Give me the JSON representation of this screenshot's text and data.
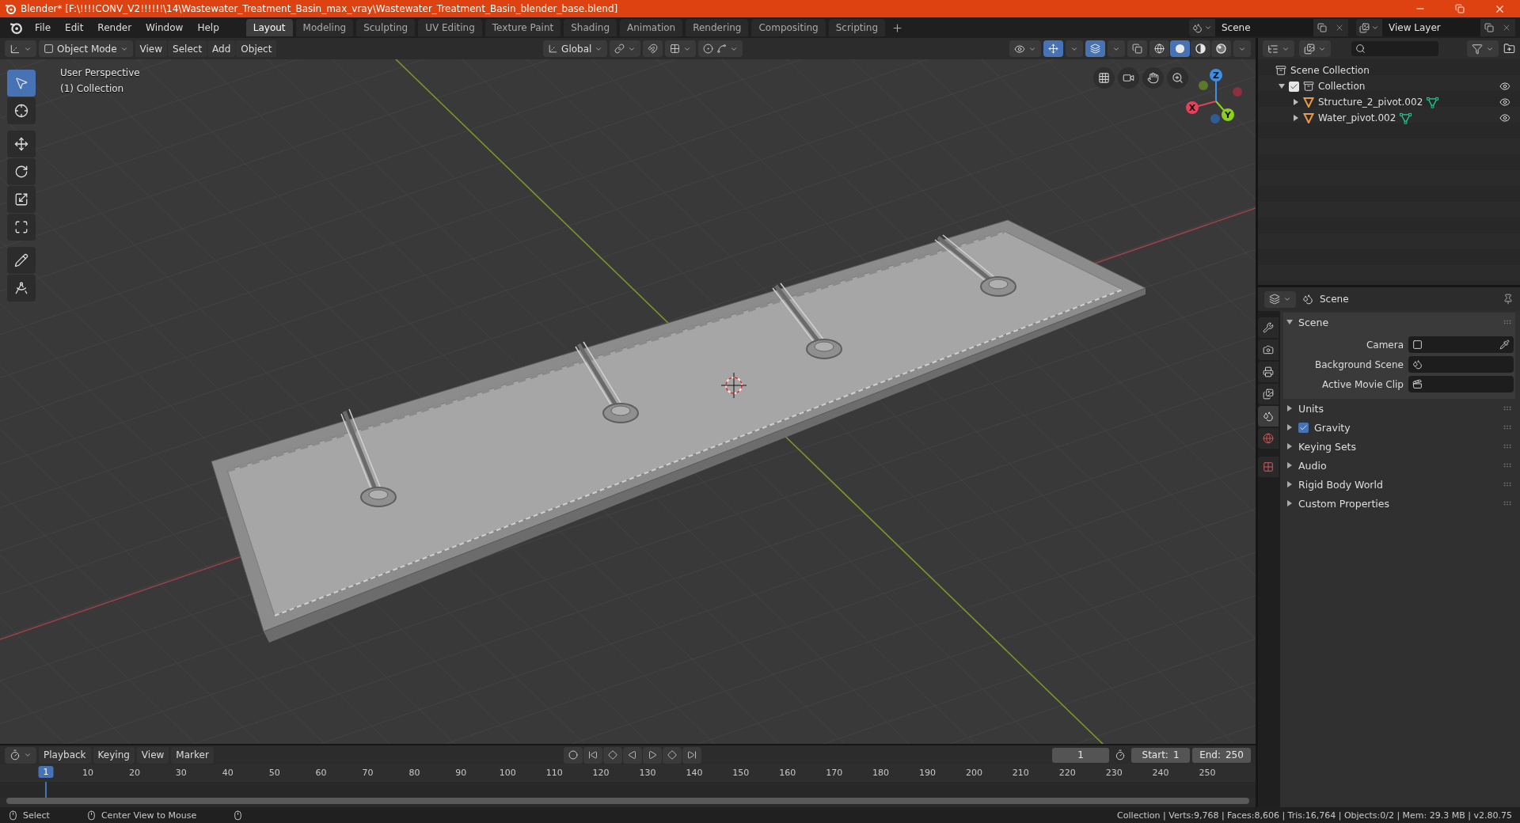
{
  "window": {
    "title": "Blender* [F:\\!!!!CONV_V2!!!!!!\\14\\Wastewater_Treatment_Basin_max_vray\\Wastewater_Treatment_Basin_blender_base.blend]"
  },
  "menu": [
    "File",
    "Edit",
    "Render",
    "Window",
    "Help"
  ],
  "workspace_tabs": [
    {
      "label": "Layout",
      "selected": true
    },
    {
      "label": "Modeling",
      "selected": false
    },
    {
      "label": "Sculpting",
      "selected": false
    },
    {
      "label": "UV Editing",
      "selected": false
    },
    {
      "label": "Texture Paint",
      "selected": false
    },
    {
      "label": "Shading",
      "selected": false
    },
    {
      "label": "Animation",
      "selected": false
    },
    {
      "label": "Rendering",
      "selected": false
    },
    {
      "label": "Compositing",
      "selected": false
    },
    {
      "label": "Scripting",
      "selected": false
    }
  ],
  "scene_selector": {
    "value": "Scene"
  },
  "view_layer_selector": {
    "value": "View Layer"
  },
  "viewport": {
    "mode": "Object Mode",
    "menus": [
      "View",
      "Select",
      "Add",
      "Object"
    ],
    "orientation": "Global",
    "overlay_text": [
      "User Perspective",
      "(1) Collection"
    ],
    "tools": [
      {
        "kind": "select",
        "selected": true
      },
      {
        "kind": "cursor",
        "selected": false
      },
      {
        "kind": "move",
        "selected": false
      },
      {
        "kind": "rotate",
        "selected": false
      },
      {
        "kind": "scale",
        "selected": false
      },
      {
        "kind": "transform",
        "selected": false
      },
      {
        "kind": "annotate",
        "selected": false
      },
      {
        "kind": "measure",
        "selected": false
      }
    ],
    "shading_modes": [
      {
        "kind": "wireframe",
        "selected": false
      },
      {
        "kind": "solid",
        "selected": true
      },
      {
        "kind": "material",
        "selected": false
      },
      {
        "kind": "rendered",
        "selected": false
      }
    ],
    "gizmo_axes": [
      "X",
      "Y",
      "Z"
    ]
  },
  "outliner": {
    "root": "Scene Collection",
    "items": [
      {
        "label": "Collection",
        "expanded": true,
        "checked": true,
        "children": [
          {
            "label": "Structure_2_pivot.002",
            "expanded": false
          },
          {
            "label": "Water_pivot.002",
            "expanded": false
          }
        ]
      }
    ]
  },
  "properties": {
    "context": "Scene",
    "tabs": [
      {
        "kind": "tool",
        "selected": false
      },
      {
        "kind": "render",
        "selected": false
      },
      {
        "kind": "output",
        "selected": false
      },
      {
        "kind": "view_layer",
        "selected": false
      },
      {
        "kind": "scene",
        "selected": true
      },
      {
        "kind": "world",
        "selected": false
      },
      {
        "kind": "texture",
        "selected": false
      }
    ],
    "panels": [
      {
        "title": "Scene",
        "expanded": true,
        "fields": [
          {
            "kind": "camera",
            "label": "Camera"
          },
          {
            "kind": "scene",
            "label": "Background Scene"
          },
          {
            "kind": "clip",
            "label": "Active Movie Clip"
          }
        ]
      },
      {
        "title": "Units",
        "expanded": false
      },
      {
        "title": "Gravity",
        "expanded": false,
        "checked": true
      },
      {
        "title": "Keying Sets",
        "expanded": false
      },
      {
        "title": "Audio",
        "expanded": false
      },
      {
        "title": "Rigid Body World",
        "expanded": false
      },
      {
        "title": "Custom Properties",
        "expanded": false
      }
    ]
  },
  "timeline": {
    "menus": [
      "Playback",
      "Keying",
      "View",
      "Marker"
    ],
    "current_frame": "1",
    "start_label": "Start:",
    "start": "1",
    "end_label": "End:",
    "end": "250",
    "playhead": "1",
    "frame_labels": [
      "10",
      "20",
      "30",
      "40",
      "50",
      "60",
      "70",
      "80",
      "90",
      "100",
      "110",
      "120",
      "130",
      "140",
      "150",
      "160",
      "170",
      "180",
      "190",
      "200",
      "210",
      "220",
      "230",
      "240",
      "250"
    ]
  },
  "status_bar": {
    "hints": [
      "Select",
      "Center View to Mouse"
    ],
    "stats": "Collection | Verts:9,768 | Faces:8,606 | Tris:16,764 | Objects:0/2 | Mem: 29.3 MB | v2.80.75"
  }
}
